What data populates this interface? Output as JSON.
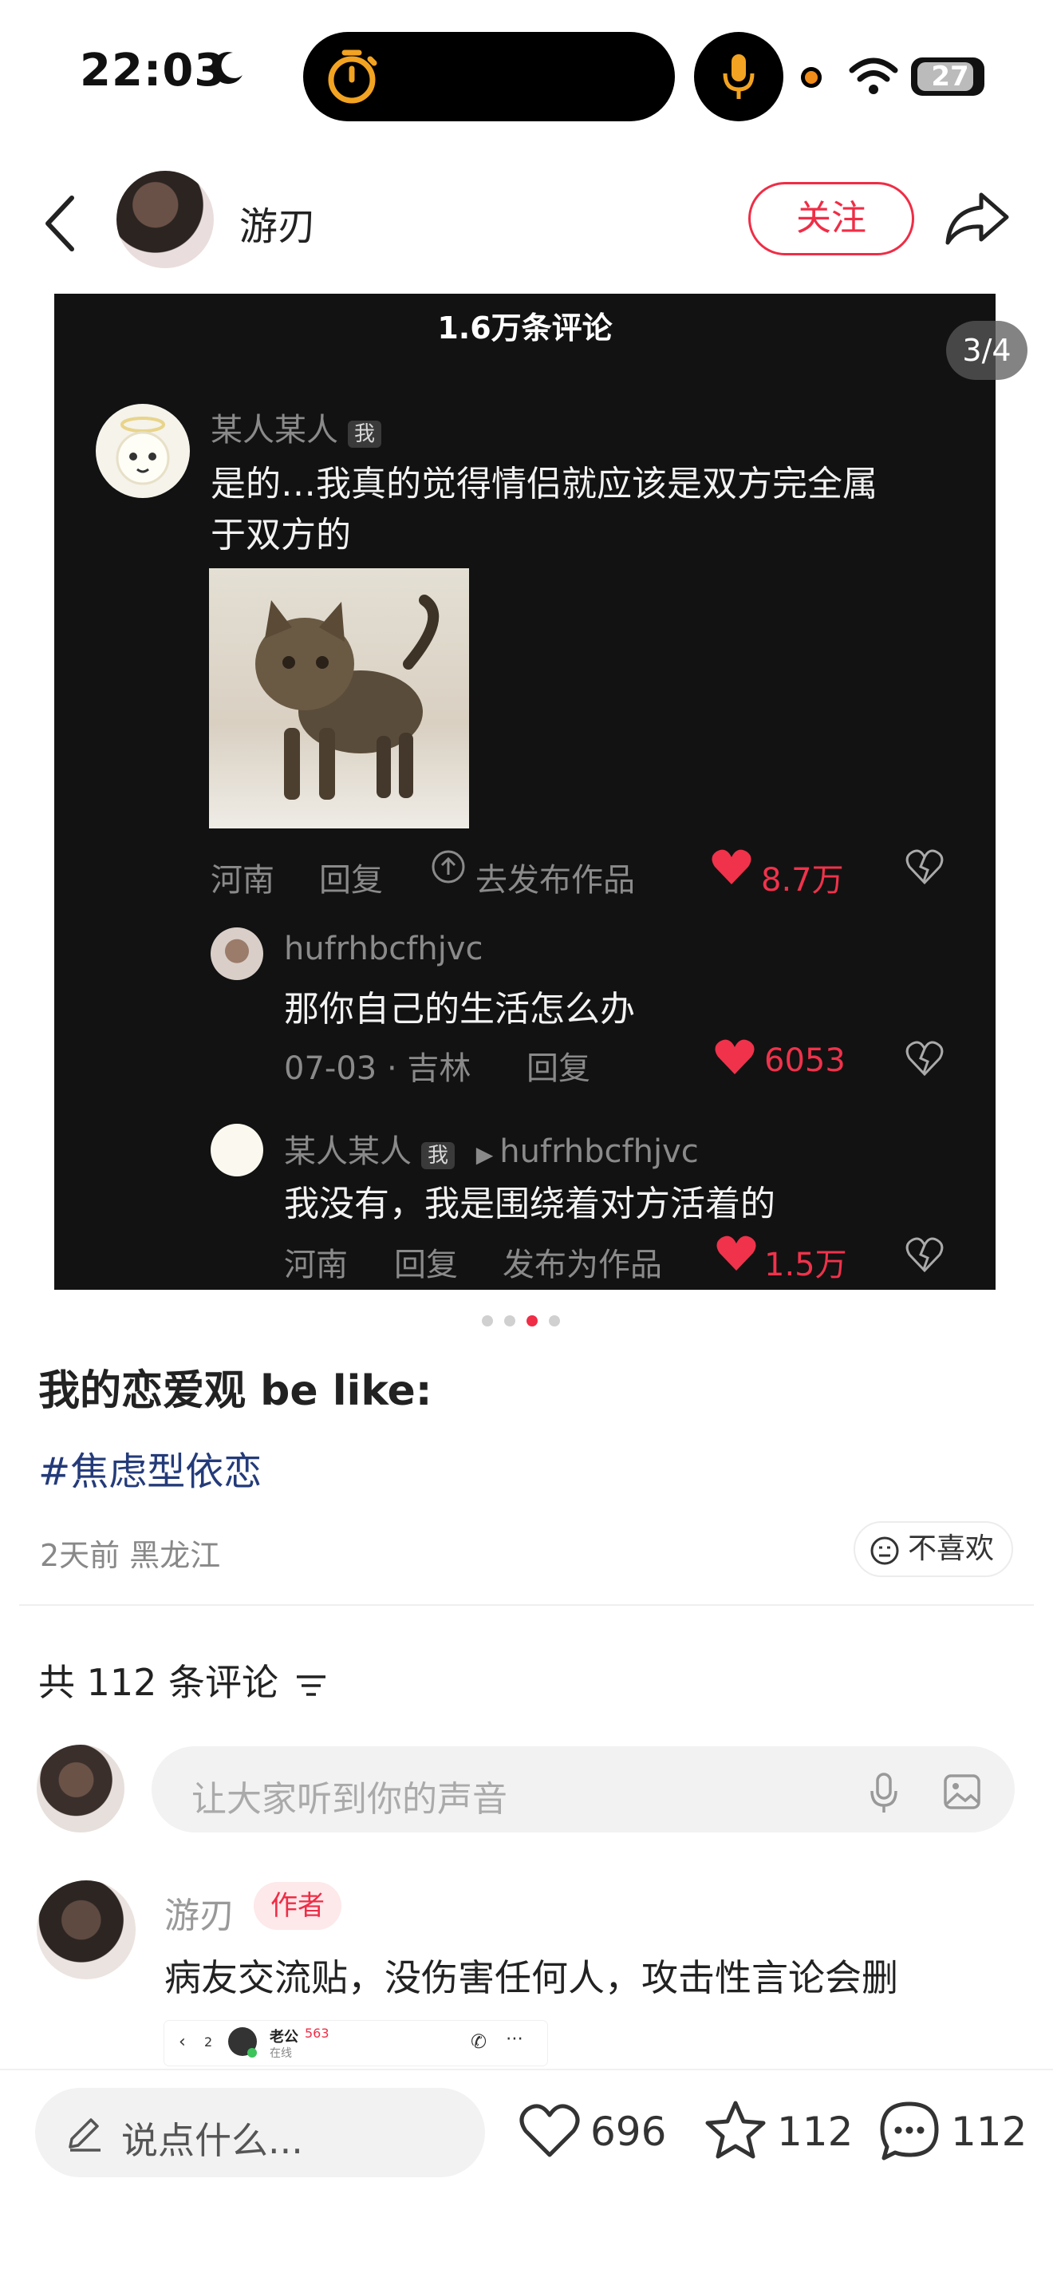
{
  "status_bar": {
    "time": "22:03",
    "battery": "27"
  },
  "header": {
    "username": "游刃",
    "follow_label": "关注"
  },
  "image_card": {
    "title": "1.6万条评论",
    "page_indicator": "3/4",
    "comment": {
      "author": "某人某人",
      "me_tag": "我",
      "text_line1": "是的…我真的觉得情侣就应该是双方完全属",
      "text_line2": "于双方的",
      "location": "河南",
      "reply": "回复",
      "publish": "去发布作品",
      "likes": "8.7万"
    },
    "reply1": {
      "author": "hufrhbcfhjvc",
      "text": "那你自己的生活怎么办",
      "date_loc": "07-03 · 吉林",
      "reply": "回复",
      "likes": "6053"
    },
    "reply2": {
      "author": "某人某人",
      "me_tag": "我",
      "target": "hufrhbcfhjvc",
      "text": "我没有，我是围绕着对方活着的",
      "location": "河南",
      "reply": "回复",
      "publish": "发布为作品",
      "likes": "1.5万"
    }
  },
  "post": {
    "title": "我的恋爱观 be like:",
    "tag": "#焦虑型依恋",
    "meta": "2天前 黑龙江",
    "dislike_label": "不喜欢"
  },
  "comments": {
    "count_label": "共 112 条评论",
    "input_placeholder": "让大家听到你的声音",
    "first": {
      "author": "游刃",
      "badge": "作者",
      "text": "病友交流贴，没伤害任何人，攻击性言论会删",
      "thumb_name": "老公",
      "thumb_status": "在线",
      "thumb_badge": "563",
      "thumb_count": "2"
    }
  },
  "bottom_bar": {
    "say_placeholder": "说点什么...",
    "likes": "696",
    "stars": "112",
    "comments": "112"
  },
  "colors": {
    "accent": "#ef2d46",
    "tag": "#243b7a",
    "card_bg": "#121212"
  }
}
